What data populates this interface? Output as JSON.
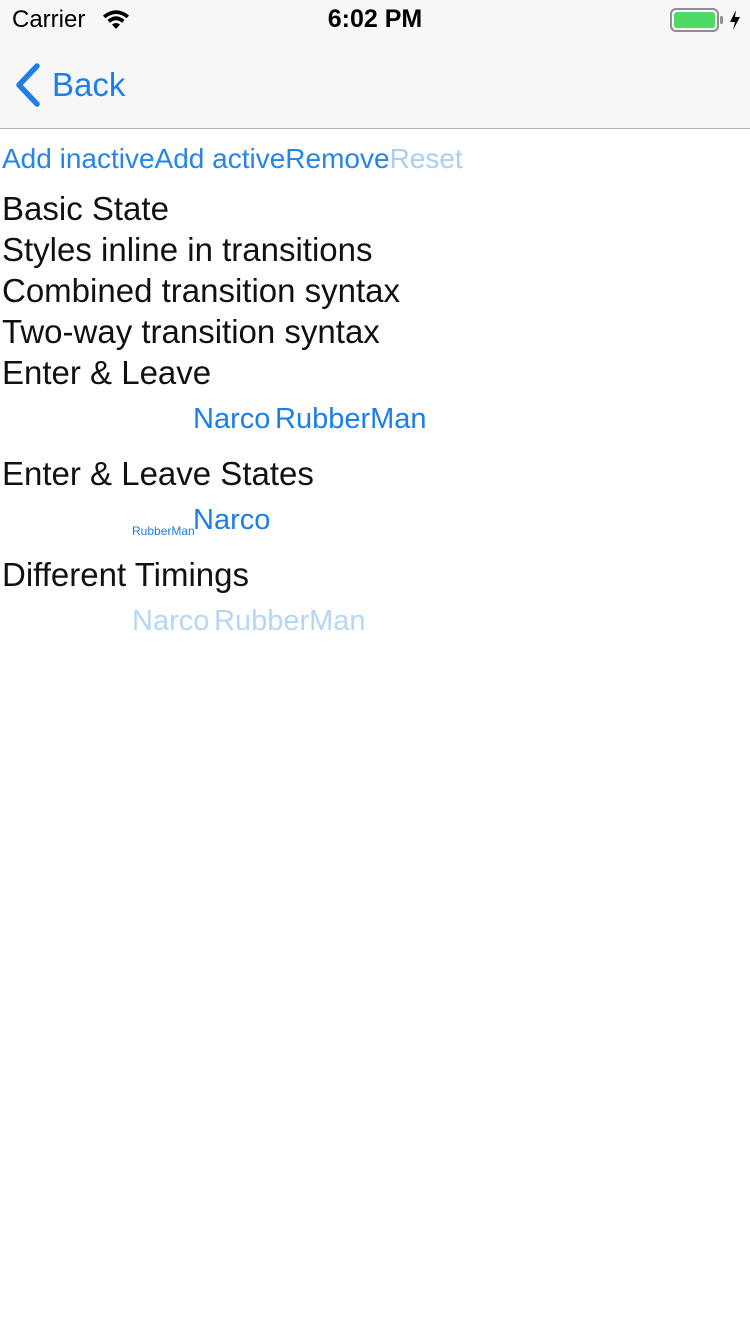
{
  "status_bar": {
    "carrier": "Carrier",
    "time": "6:02 PM",
    "battery_color": "#4cd964"
  },
  "nav": {
    "back_label": "Back",
    "accent_color": "#1c7ee6"
  },
  "toolbar": {
    "add_inactive": "Add inactive",
    "add_active": "Add active",
    "remove": "Remove",
    "reset": "Reset"
  },
  "sections": {
    "basic_state": "Basic State",
    "styles_inline": "Styles inline in transitions",
    "combined": "Combined transition syntax",
    "two_way": "Two-way transition syntax",
    "enter_leave": "Enter & Leave",
    "enter_leave_states": "Enter & Leave States",
    "different_timings": "Different Timings"
  },
  "demos": {
    "enter_leave": {
      "a": "Narco",
      "b": "RubberMan"
    },
    "enter_leave_states": {
      "small": "RubberMan",
      "a": "Narco"
    },
    "different_timings": {
      "a": "Narco",
      "b": "RubberMan"
    }
  }
}
